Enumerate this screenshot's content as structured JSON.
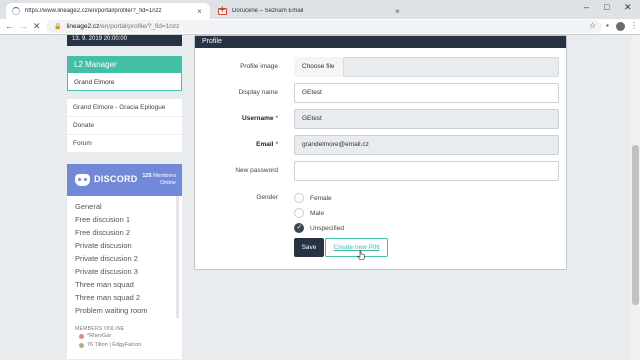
{
  "browser": {
    "tabs": [
      {
        "title": "https://www.lineage2.cz/en/portal/profile/?_fid=1nzz",
        "active": true
      },
      {
        "title": "Doručené – Seznam Email",
        "active": false
      }
    ],
    "new_tab": "+",
    "url_host": "lineage2.cz",
    "url_path": "/en/portal/profile/?_fid=1nzz"
  },
  "sidebar": {
    "date": "13. 9. 2019 20:00:00",
    "l2_manager": {
      "title": "L2 Manager",
      "item": "Grand Elmore"
    },
    "links": [
      "Grand Elmore - Gracia Epilogue",
      "Donate",
      "Forum"
    ]
  },
  "discord": {
    "name": "DISCORD",
    "members_count": "125",
    "members_label_1": "Members",
    "members_label_2": "Online",
    "channels": [
      "General",
      "Free discusion 1",
      "Free discusion 2",
      "Private discusion",
      "Private discusion 2",
      "Private discusion 3",
      "Three man squad",
      "Three man squad 2",
      "Problem waiting room"
    ],
    "online_label": "MEMBERS ONLINE",
    "users": [
      "*RhevGar",
      "76 Tilton | EdgyFalcon"
    ]
  },
  "profile": {
    "title": "Profile",
    "labels": {
      "image": "Profile image",
      "display_name": "Display name",
      "username": "Username",
      "email": "Email",
      "new_password": "New password",
      "gender": "Gender"
    },
    "required_mark": "*",
    "choose_file": "Choose file",
    "display_name_value": "GEtest",
    "username_value": "GEtest",
    "email_value": "grandelmore@email.cz",
    "new_password_value": "",
    "gender_options": [
      "Female",
      "Male",
      "Unspecified"
    ],
    "gender_selected": "Unspecified",
    "save_label": "Save",
    "pin_label": "Create new PIN"
  }
}
